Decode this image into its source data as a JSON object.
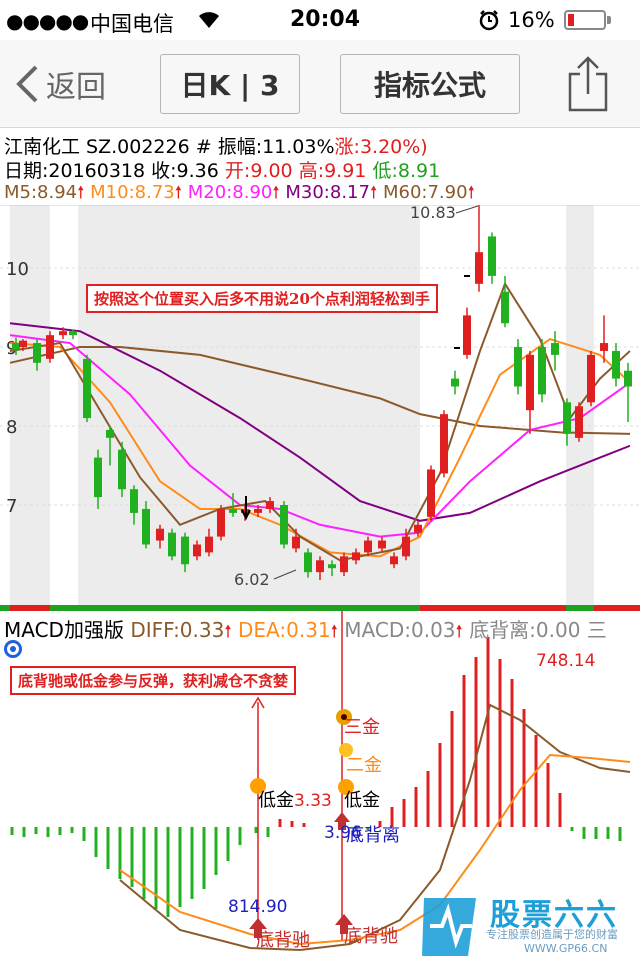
{
  "status_bar": {
    "signal": "●●●●●",
    "carrier": "中国电信",
    "time": "20:04",
    "battery": "16%"
  },
  "nav": {
    "back_label": "返回",
    "period_label": "日K | 3",
    "formula_label": "指标公式"
  },
  "stock": {
    "name_code": "江南化工 SZ.002226",
    "amp_label": "# 振幅:11.03%",
    "change_label": "涨:3.20%)",
    "date_label": "日期:20160318",
    "close_label": "收:9.36",
    "open_label": "开:9.00",
    "high_label": "高:9.91",
    "low_label": "低:8.91"
  },
  "ma": {
    "m5": "M5:8.94",
    "m10": "M10:8.73",
    "m20": "M20:8.90",
    "m30": "M30:8.17",
    "m60": "M60:7.90"
  },
  "kline": {
    "y_ticks": [
      "10",
      "9",
      "8",
      "7"
    ],
    "high_mark": "10.83",
    "low_mark": "6.02",
    "annotation": "按照这个位置买入后多不用说20个点利润轻松到手"
  },
  "macd": {
    "title": "MACD加强版",
    "diff": "DIFF:0.33",
    "dea": "DEA:0.31",
    "macd": "MACD:0.03",
    "dbl": "底背离:0.00",
    "more": "三",
    "annotation": "底背驰或低金参与反弹，获利减仓不贪婪",
    "peak_value": "748.14",
    "low_value": "814.90",
    "v_333": "3.33",
    "v_396": "3.96",
    "san_jin": "三金",
    "er_jin": "二金",
    "di_jin_1": "低金",
    "di_jin_2": "低金",
    "di_bei_li": "底背离",
    "di_bei_chi_1": "底背驰",
    "di_bei_chi_2": "底背驰"
  },
  "logo": {
    "title": "股票六六",
    "slogan": "专注股票创造属于您的财富",
    "url": "WWW.GP66.CN"
  },
  "colors": {
    "up": "#e02020",
    "down": "#20b020",
    "ma5": "#8b5a2b",
    "ma10": "#ff8c1a",
    "ma20": "#ff20ff",
    "ma30": "#800080",
    "ma60": "#8b5a2b"
  }
}
